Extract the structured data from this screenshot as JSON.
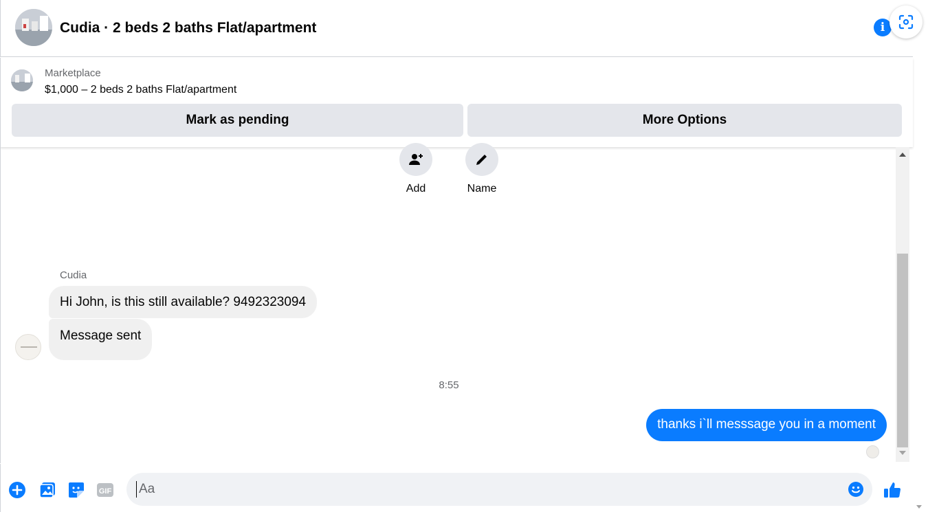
{
  "header": {
    "title": "Cudia · 2 beds 2 baths Flat/apartment",
    "info_icon": "info-icon",
    "info_glyph": "i",
    "scan_icon": "scan-icon"
  },
  "marketplace": {
    "label": "Marketplace",
    "listing": "$1,000 – 2 beds 2 baths Flat/apartment",
    "mark_pending_label": "Mark as pending",
    "more_options_label": "More Options"
  },
  "actions": {
    "add_label": "Add",
    "name_label": "Name"
  },
  "messages": {
    "sender_name": "Cudia",
    "incoming": [
      "Hi John, is this still available? 9492323094",
      "Message sent"
    ],
    "timestamp": "8:55",
    "outgoing": "thanks i`ll messsage you in a moment"
  },
  "composer": {
    "placeholder": "Aa",
    "icons": [
      "plus-circle-icon",
      "photo-icon",
      "sticker-icon",
      "gif-icon",
      "emoji-icon",
      "thumbs-up-icon"
    ],
    "gif_label": "GIF"
  },
  "colors": {
    "accent": "#0a7cff",
    "button_bg": "#e4e6eb",
    "bubble_in": "#f0f0f0",
    "muted_text": "#65676b"
  }
}
